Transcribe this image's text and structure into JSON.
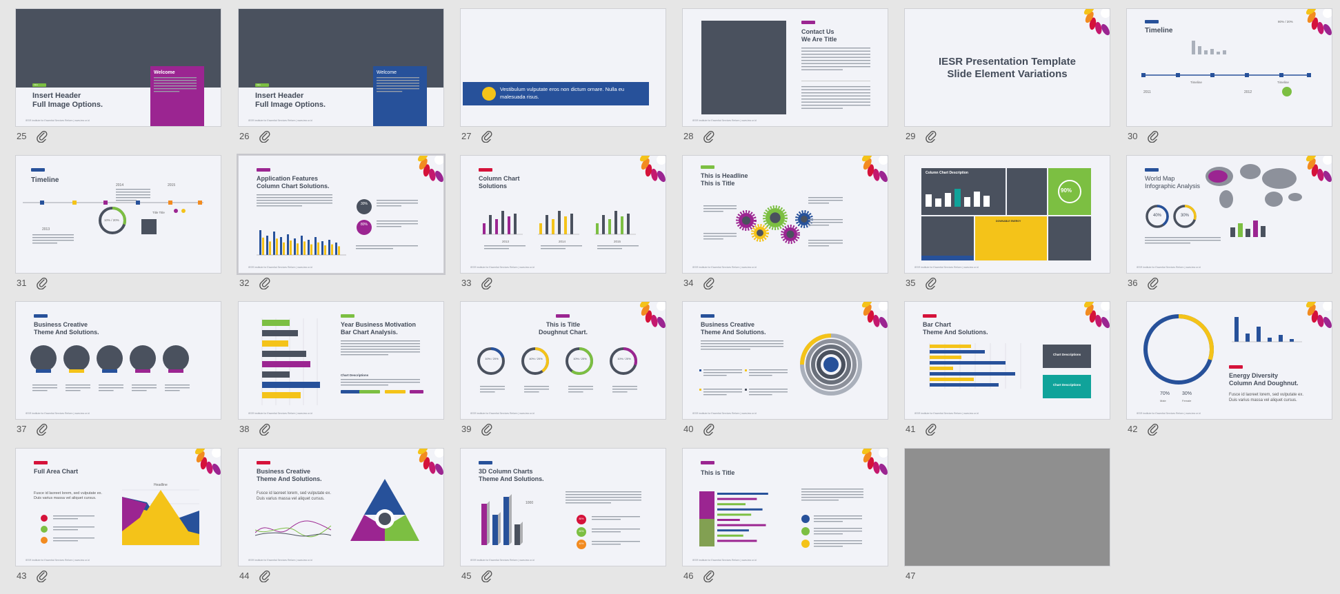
{
  "colors": {
    "dark": "#4a515e",
    "blue": "#27519a",
    "magenta": "#9b2591",
    "yellow": "#f4c319",
    "green": "#7cbf42",
    "teal": "#10a39a",
    "pink": "#c4186e",
    "orange": "#f28b20",
    "red": "#d5123a",
    "slide_bg": "#f2f3f8",
    "canvas_bg": "#e6e6e6"
  },
  "footer_text": "IESR Institute for Essential Services Reform | www.iesr.or.id",
  "attachment_icon": "paperclip-icon",
  "slides": [
    {
      "number": "25",
      "title": "Insert Header\nFull Image Options.",
      "box_title": "Welcome",
      "tag": "Intro"
    },
    {
      "number": "26",
      "title": "Insert Header\nFull Image Options.",
      "box_title": "Welcome",
      "tag": "Intro"
    },
    {
      "number": "27",
      "banner": "Vestibulum vulputate eros non dictum ornare. Nulla eu malesuada risus."
    },
    {
      "number": "28",
      "title": "Contact Us\nWe Are Title"
    },
    {
      "number": "29",
      "title": "IESR Presentation Template\nSlide Element Variations"
    },
    {
      "number": "30",
      "title": "Timeline",
      "years": [
        "2011",
        "2012"
      ],
      "labels": [
        "Timeline",
        "Timeline"
      ],
      "stat": "80% / 20%"
    },
    {
      "number": "31",
      "title": "Timeline",
      "years": [
        "2013",
        "2014",
        "2015"
      ],
      "donut": "10% / 20%",
      "label": "Title Title"
    },
    {
      "number": "32",
      "title": "Application Features\nColumn Chart Solutions.",
      "circles": [
        "30%",
        "80%"
      ]
    },
    {
      "number": "33",
      "title": "Column Chart\nSolutions",
      "years": [
        "2013",
        "2014",
        "2015"
      ]
    },
    {
      "number": "34",
      "title": "This is Headline\nThis is Title"
    },
    {
      "number": "35",
      "title": "Column Chart Description",
      "stat": "90%",
      "label": "DOWNABLE ENERGY"
    },
    {
      "number": "36",
      "title": "World Map\nInfographic Analysis",
      "stats": [
        "40%",
        "30%"
      ]
    },
    {
      "number": "37",
      "title": "Business Creative\nTheme And Solutions."
    },
    {
      "number": "38",
      "title": "Year Business Motivation\nBar Chart Analysis.",
      "sub": "Chart Descriptions"
    },
    {
      "number": "39",
      "title": "This is Title\nDoughnut Chart.",
      "donuts": [
        "10% / 20%",
        "40% / 20%",
        "10% / 20%",
        "10% / 20%"
      ]
    },
    {
      "number": "40",
      "title": "Business Creative\nTheme And Solutions."
    },
    {
      "number": "41",
      "title": "Bar Chart\nTheme And Solutions.",
      "boxes": [
        "Chart Descriptions",
        "Chart Descriptions"
      ]
    },
    {
      "number": "42",
      "title": "Energy Diversity\nColumn And Doughnut.",
      "stats": [
        "70%",
        "30%"
      ],
      "stat_labels": [
        "Male",
        "Female"
      ],
      "text": "Fusce id laoreet lorem, sed vulputate ex. Duis varius massa vel aliquet cursus."
    },
    {
      "number": "43",
      "title": "Full Area Chart",
      "text": "Fusce id laoreet lorem, sed vulputate ex. Duis varius massa vel aliquet cursus.",
      "annotation": "Headline"
    },
    {
      "number": "44",
      "title": "Business Creative\nTheme And Solutions.",
      "text": "Fusce id laoreet lorem, sed vulputate ex. Duis varius massa vel aliquet cursus."
    },
    {
      "number": "45",
      "title": "3D Column Charts\nTheme And Solutions.",
      "annotation": "1000",
      "circles": [
        "80%",
        "60%",
        "40%"
      ]
    },
    {
      "number": "46",
      "title": "This is Title"
    },
    {
      "number": "47"
    }
  ]
}
